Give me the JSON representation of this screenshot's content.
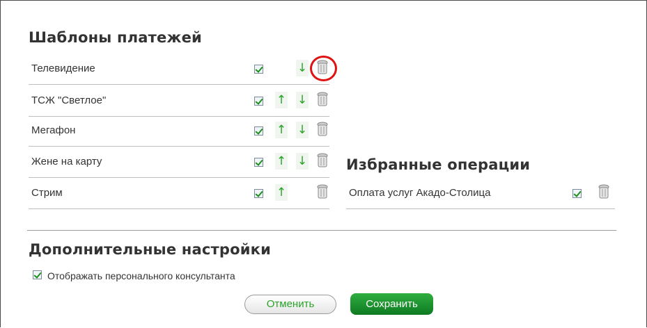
{
  "templates": {
    "title": "Шаблоны платежей",
    "items": [
      {
        "label": "Телевидение"
      },
      {
        "label": "ТСЖ \"Светлое\""
      },
      {
        "label": "Мегафон"
      },
      {
        "label": "Жене на карту"
      },
      {
        "label": "Стрим"
      }
    ],
    "up_glyph": "↑",
    "down_glyph": "↓"
  },
  "favorites": {
    "title": "Избранные операции",
    "items": [
      {
        "label": "Оплата услуг Акадо-Столица"
      }
    ]
  },
  "extra": {
    "title": "Дополнительные настройки",
    "personal_consultant_label": "Отображать персонального консультанта"
  },
  "buttons": {
    "cancel": "Отменить",
    "save": "Сохранить"
  },
  "icons": {
    "checkbox": "checkbox-checked-icon",
    "up": "arrow-up-icon",
    "down": "arrow-down-icon",
    "delete": "trash-icon"
  },
  "colors": {
    "accent_green": "#29a329",
    "save_button": "#1a9a30",
    "highlight_circle": "#e01212"
  }
}
